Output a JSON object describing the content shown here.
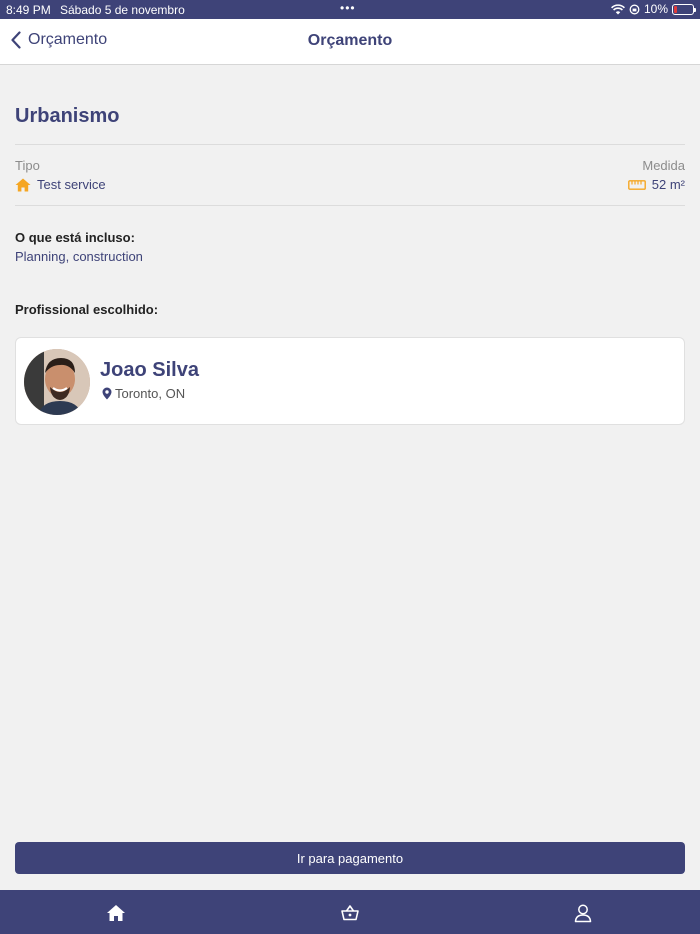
{
  "status_bar": {
    "time": "8:49 PM",
    "date": "Sábado 5 de novembro",
    "dots": "•••",
    "battery": "10%",
    "battery_level": 0.1
  },
  "nav": {
    "back_label": "Orçamento",
    "title": "Orçamento"
  },
  "service": {
    "title": "Urbanismo",
    "type_label": "Tipo",
    "type_value": "Test service",
    "measure_label": "Medida",
    "measure_value": "52 m²"
  },
  "included": {
    "label": "O que está incluso:",
    "text": "Planning, construction"
  },
  "professional": {
    "label": "Profissional escolhido:",
    "name": "Joao Silva",
    "location": "Toronto, ON"
  },
  "actions": {
    "pay_label": "Ir para pagamento"
  },
  "tabbar": {
    "icons": [
      "home-icon",
      "basket-icon",
      "user-icon"
    ]
  },
  "colors": {
    "primary": "#3e4378",
    "accent": "#f5a623",
    "background": "#f1f1f1"
  }
}
